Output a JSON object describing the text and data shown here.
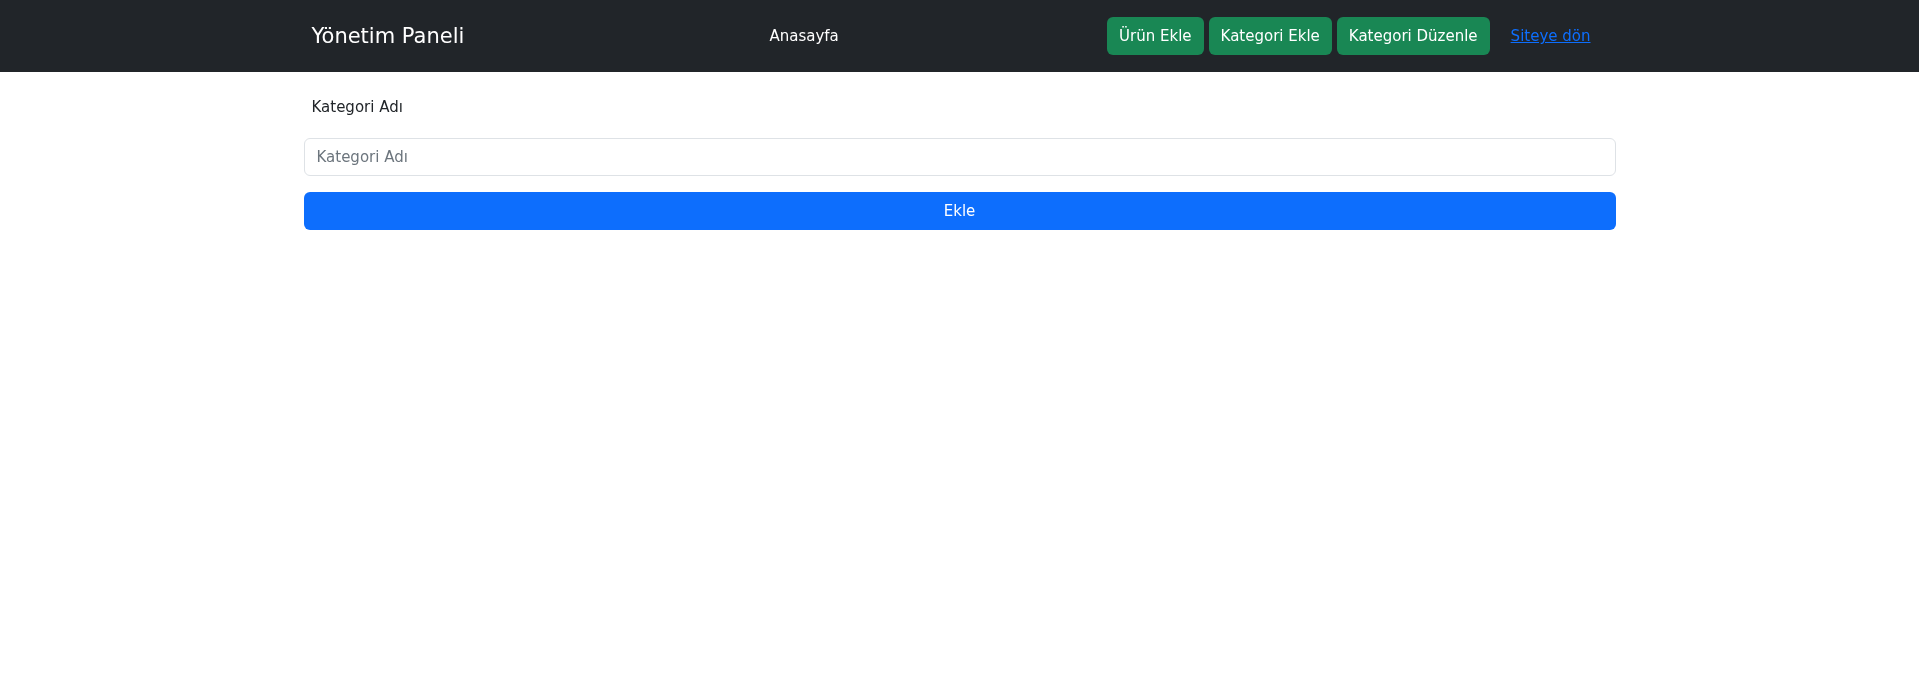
{
  "navbar": {
    "brand": "Yönetim Paneli",
    "center_links": [
      {
        "kind": "link",
        "label": "Anasayfa"
      }
    ],
    "actions": [
      {
        "kind": "button",
        "label": "Ürün Ekle"
      },
      {
        "kind": "button",
        "label": "Kategori Ekle"
      },
      {
        "kind": "button",
        "label": "Kategori Düzenle"
      },
      {
        "kind": "link",
        "label": "Siteye dön"
      }
    ]
  },
  "form": {
    "label": "Kategori Adı",
    "input": {
      "placeholder": "Kategori Adı"
    },
    "submit": "Ekle"
  }
}
